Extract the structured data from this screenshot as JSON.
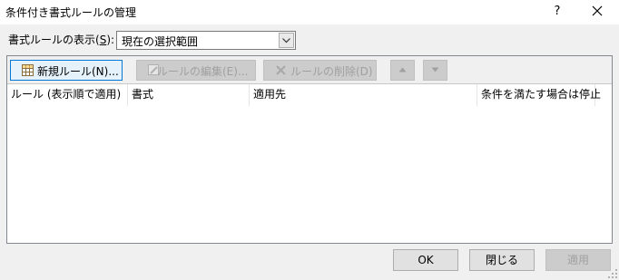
{
  "window": {
    "title": "条件付き書式ルールの管理",
    "help_label": "?",
    "close_icon": "close-icon"
  },
  "scope": {
    "label_prefix": "書式ルールの表示(",
    "label_key": "S",
    "label_suffix": "):",
    "selected": "現在の選択範囲"
  },
  "toolbar": {
    "new_rule": "新規ルール(N)...",
    "edit_rule": "ルールの編集(E)...",
    "delete_rule": "ルールの削除(D)",
    "move_up_icon": "arrow-up-icon",
    "move_down_icon": "arrow-down-icon"
  },
  "columns": [
    "ルール (表示順で適用)",
    "書式",
    "適用先",
    "条件を満たす場合は停止"
  ],
  "rules": [],
  "buttons": {
    "ok": "OK",
    "close": "閉じる",
    "apply": "適用"
  },
  "colors": {
    "dialog_bg": "#f0f0f0",
    "focus_border": "#0078d7",
    "disabled_text": "#a0a0a0"
  }
}
